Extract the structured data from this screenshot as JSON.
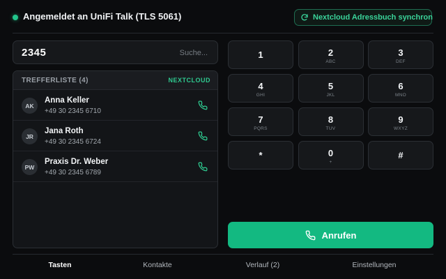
{
  "header": {
    "status_text": "Angemeldet an UniFi Talk (TLS 5061)",
    "status_color": "#22c58b",
    "sync_label": "Nextcloud Adressbuch synchron",
    "sync_icon": "refresh-icon"
  },
  "search": {
    "value": "2345",
    "hint": "Suche..."
  },
  "results": {
    "title": "TREFFERLISTE (4)",
    "source": "NEXTCLOUD",
    "contacts": [
      {
        "initials": "AK",
        "name": "Anna Keller",
        "number": "+49 30 2345 6710"
      },
      {
        "initials": "JR",
        "name": "Jana Roth",
        "number": "+49 30 2345 6724"
      },
      {
        "initials": "PW",
        "name": "Praxis Dr. Weber",
        "number": "+49 30 2345 6789"
      }
    ]
  },
  "keypad": {
    "keys": [
      {
        "digit": "1",
        "letters": ""
      },
      {
        "digit": "2",
        "letters": "ABC"
      },
      {
        "digit": "3",
        "letters": "DEF"
      },
      {
        "digit": "4",
        "letters": "GHI"
      },
      {
        "digit": "5",
        "letters": "JKL"
      },
      {
        "digit": "6",
        "letters": "MNO"
      },
      {
        "digit": "7",
        "letters": "PQRS"
      },
      {
        "digit": "8",
        "letters": "TUV"
      },
      {
        "digit": "9",
        "letters": "WXYZ"
      },
      {
        "digit": "*",
        "letters": ""
      },
      {
        "digit": "0",
        "letters": "+"
      },
      {
        "digit": "#",
        "letters": ""
      }
    ]
  },
  "call": {
    "label": "Anrufen",
    "color": "#13b981"
  },
  "tabs": [
    {
      "label": "Tasten",
      "active": true
    },
    {
      "label": "Kontakte",
      "active": false
    },
    {
      "label": "Verlauf (2)",
      "active": false
    },
    {
      "label": "Einstellungen",
      "active": false
    }
  ]
}
